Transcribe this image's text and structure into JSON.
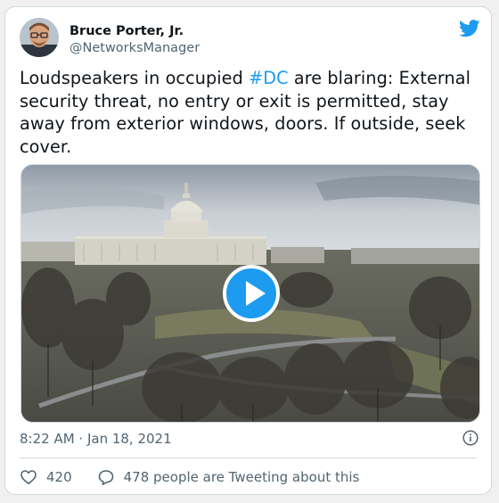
{
  "author": {
    "name": "Bruce Porter, Jr.",
    "handle": "@NetworksManager"
  },
  "tweet": {
    "text_before": "Loudspeakers in occupied ",
    "hashtag": "#DC",
    "text_after": " are blaring: External security threat, no entry or exit is permitted, stay away from exterior windows, doors. If outside, seek cover."
  },
  "media": {
    "type": "video",
    "icon": "play-icon"
  },
  "timestamp": "8:22 AM · Jan 18, 2021",
  "stats": {
    "likes": "420",
    "replies_text": "478 people are Tweeting about this"
  },
  "colors": {
    "accent": "#1d9bf0",
    "text": "#0f1419",
    "muted": "#536471",
    "border": "#cfd9de"
  }
}
